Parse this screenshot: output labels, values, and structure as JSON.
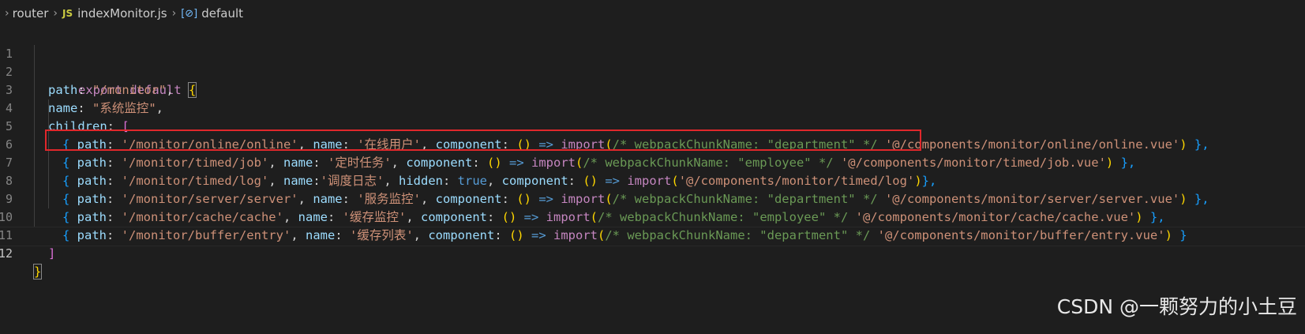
{
  "breadcrumb": {
    "folder": "router",
    "file_badge": "JS",
    "file": "indexMonitor.js",
    "symbol_badge": "[⊘]",
    "symbol": "default"
  },
  "line_numbers": [
    "1",
    "2",
    "3",
    "4",
    "5",
    "6",
    "7",
    "8",
    "9",
    "10",
    "11",
    "12"
  ],
  "code": {
    "l1": {
      "kw": "export",
      "kw2": "default",
      "brace": "{"
    },
    "l2": {
      "key": "path",
      "colon": ": ",
      "val": "\"/monitor\"",
      "comma": ","
    },
    "l3": {
      "key": "name",
      "colon": ": ",
      "val": "\"系统监控\"",
      "comma": ","
    },
    "l4": {
      "key": "children",
      "colon": ": ",
      "bracket": "["
    },
    "l5": {
      "open": "{ ",
      "k1": "path",
      "c1": ": ",
      "v1": "'/monitor/online/online'",
      "s1": ", ",
      "k2": "name",
      "c2": ": ",
      "v2": "'在线用户'",
      "s2": ", ",
      "k3": "component",
      "c3": ": ",
      "paren": "()",
      "arrow": " => ",
      "fn": "import",
      "po": "(",
      "cmt": "/* webpackChunkName: \"department\" */",
      "sp": " ",
      "v3": "'@/components/monitor/online/online.vue'",
      "pc": ")",
      "close": " },"
    },
    "l6": {
      "open": "{ ",
      "k1": "path",
      "c1": ": ",
      "v1": "'/monitor/timed/job'",
      "s1": ", ",
      "k2": "name",
      "c2": ": ",
      "v2": "'定时任务'",
      "s2": ", ",
      "k3": "component",
      "c3": ": ",
      "paren": "()",
      "arrow": " => ",
      "fn": "import",
      "po": "(",
      "cmt": "/* webpackChunkName: \"employee\" */",
      "sp": " ",
      "v3": "'@/components/monitor/timed/job.vue'",
      "pc": ")",
      "close": " },"
    },
    "l7": {
      "open": "{ ",
      "k1": "path",
      "c1": ": ",
      "v1": "'/monitor/timed/log'",
      "s1": ", ",
      "k2": "name",
      "c2": ":",
      "v2": "'调度日志'",
      "s2": ", ",
      "k4": "hidden",
      "c4": ": ",
      "bool": "true",
      "s4": ", ",
      "k3": "component",
      "c3": ": ",
      "paren": "()",
      "arrow": " => ",
      "fn": "import",
      "po": "(",
      "v3": "'@/components/monitor/timed/log'",
      "pc": ")",
      "close": "},"
    },
    "l8": {
      "open": "{ ",
      "k1": "path",
      "c1": ": ",
      "v1": "'/monitor/server/server'",
      "s1": ", ",
      "k2": "name",
      "c2": ": ",
      "v2": "'服务监控'",
      "s2": ", ",
      "k3": "component",
      "c3": ": ",
      "paren": "()",
      "arrow": " => ",
      "fn": "import",
      "po": "(",
      "cmt": "/* webpackChunkName: \"department\" */",
      "sp": " ",
      "v3": "'@/components/monitor/server/server.vue'",
      "pc": ")",
      "close": " },"
    },
    "l9": {
      "open": "{ ",
      "k1": "path",
      "c1": ": ",
      "v1": "'/monitor/cache/cache'",
      "s1": ", ",
      "k2": "name",
      "c2": ": ",
      "v2": "'缓存监控'",
      "s2": ", ",
      "k3": "component",
      "c3": ": ",
      "paren": "()",
      "arrow": " => ",
      "fn": "import",
      "po": "(",
      "cmt": "/* webpackChunkName: \"employee\" */",
      "sp": " ",
      "v3": "'@/components/monitor/cache/cache.vue'",
      "pc": ")",
      "close": " },"
    },
    "l10": {
      "open": "{ ",
      "k1": "path",
      "c1": ": ",
      "v1": "'/monitor/buffer/entry'",
      "s1": ", ",
      "k2": "name",
      "c2": ": ",
      "v2": "'缓存列表'",
      "s2": ", ",
      "k3": "component",
      "c3": ": ",
      "paren": "()",
      "arrow": " => ",
      "fn": "import",
      "po": "(",
      "cmt": "/* webpackChunkName: \"department\" */",
      "sp": " ",
      "v3": "'@/components/monitor/buffer/entry.vue'",
      "pc": ")",
      "close": " }"
    },
    "l11": {
      "bracket": "]"
    },
    "l12": {
      "brace": "}"
    }
  },
  "watermark": "CSDN @一颗努力的小土豆",
  "colors": {
    "highlight_box": "#e0272b",
    "background": "#1e1e1e"
  }
}
